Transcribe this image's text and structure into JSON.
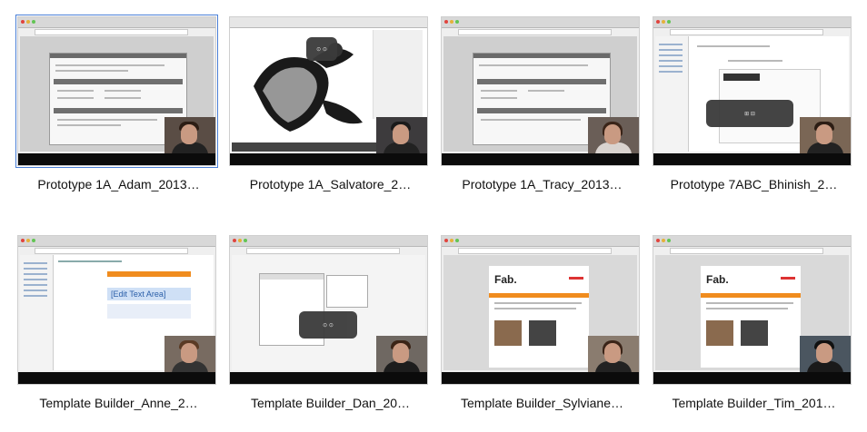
{
  "grid": {
    "items": [
      {
        "title": "Prototype 1A_Adam_2013…",
        "variant": "form",
        "selected": true
      },
      {
        "title": "Prototype 1A_Salvatore_2…",
        "variant": "art",
        "selected": false
      },
      {
        "title": "Prototype 1A_Tracy_2013…",
        "variant": "form",
        "selected": false
      },
      {
        "title": "Prototype 7ABC_Bhinish_2…",
        "variant": "email",
        "selected": false
      },
      {
        "title": "Template Builder_Anne_2…",
        "variant": "builder",
        "selected": false
      },
      {
        "title": "Template Builder_Dan_20…",
        "variant": "editor",
        "selected": false
      },
      {
        "title": "Template Builder_Sylviane…",
        "variant": "fab",
        "selected": false
      },
      {
        "title": "Template Builder_Tim_201…",
        "variant": "fab",
        "selected": false
      }
    ]
  },
  "overlays": {
    "editor_box": "⊙ ⊙",
    "email_box": "⊞ ⊟",
    "builder_text": "[Edit Text Area]",
    "fab_logo": "Fab."
  }
}
